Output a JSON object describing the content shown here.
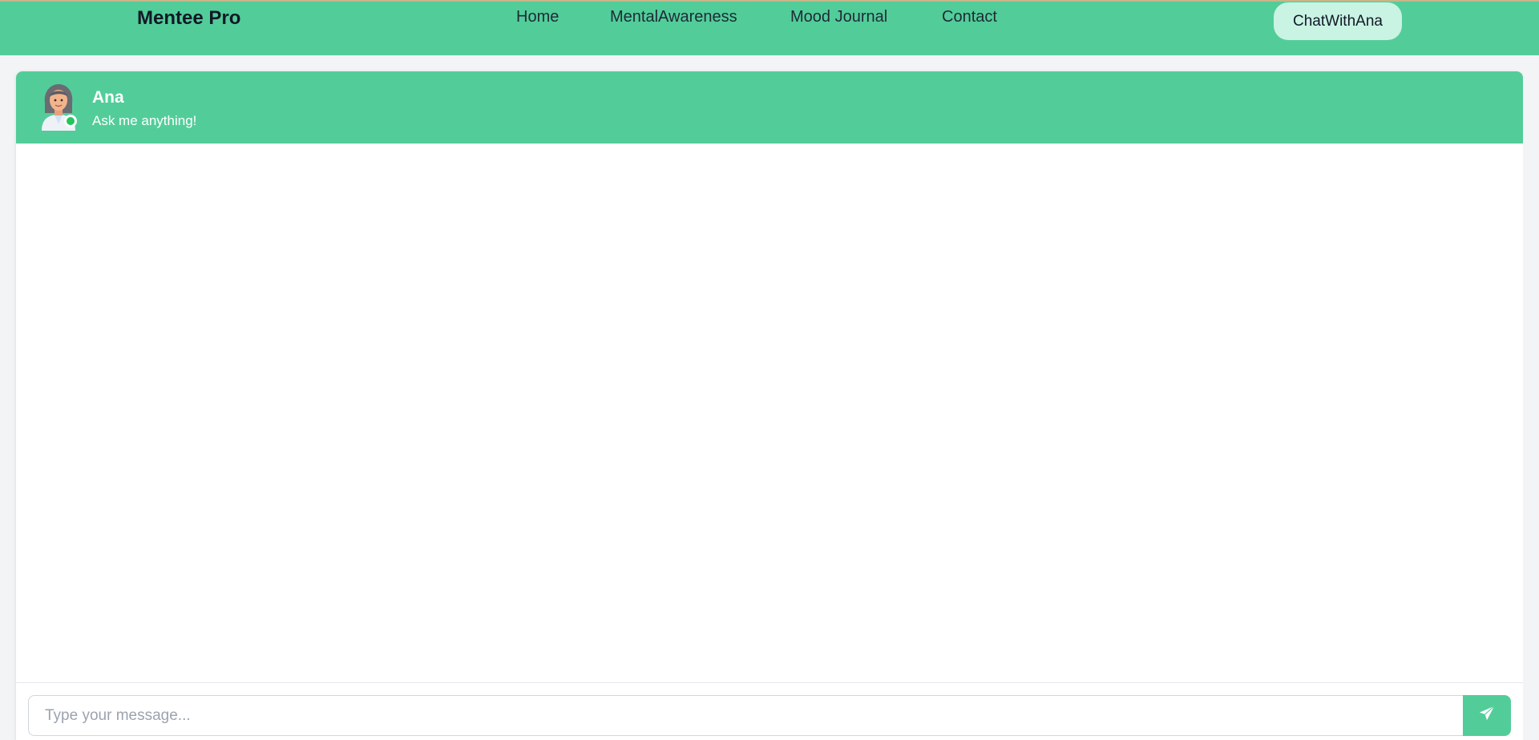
{
  "navbar": {
    "brand": "Mentee Pro",
    "links": [
      {
        "label": "Home"
      },
      {
        "label": "MentalAwareness"
      },
      {
        "label": "Mood Journal"
      },
      {
        "label": "Contact"
      }
    ],
    "cta_label": "ChatWithAna"
  },
  "chat": {
    "agent_name": "Ana",
    "agent_status": "Ask me anything!",
    "avatar_icon": "woman-avatar-icon",
    "online": true,
    "input_placeholder": "Type your message...",
    "input_value": "",
    "send_icon": "paper-plane-icon"
  },
  "colors": {
    "brand_green": "#52cd99",
    "cta_bg": "#c9f3e2",
    "online_dot": "#22c55e"
  }
}
